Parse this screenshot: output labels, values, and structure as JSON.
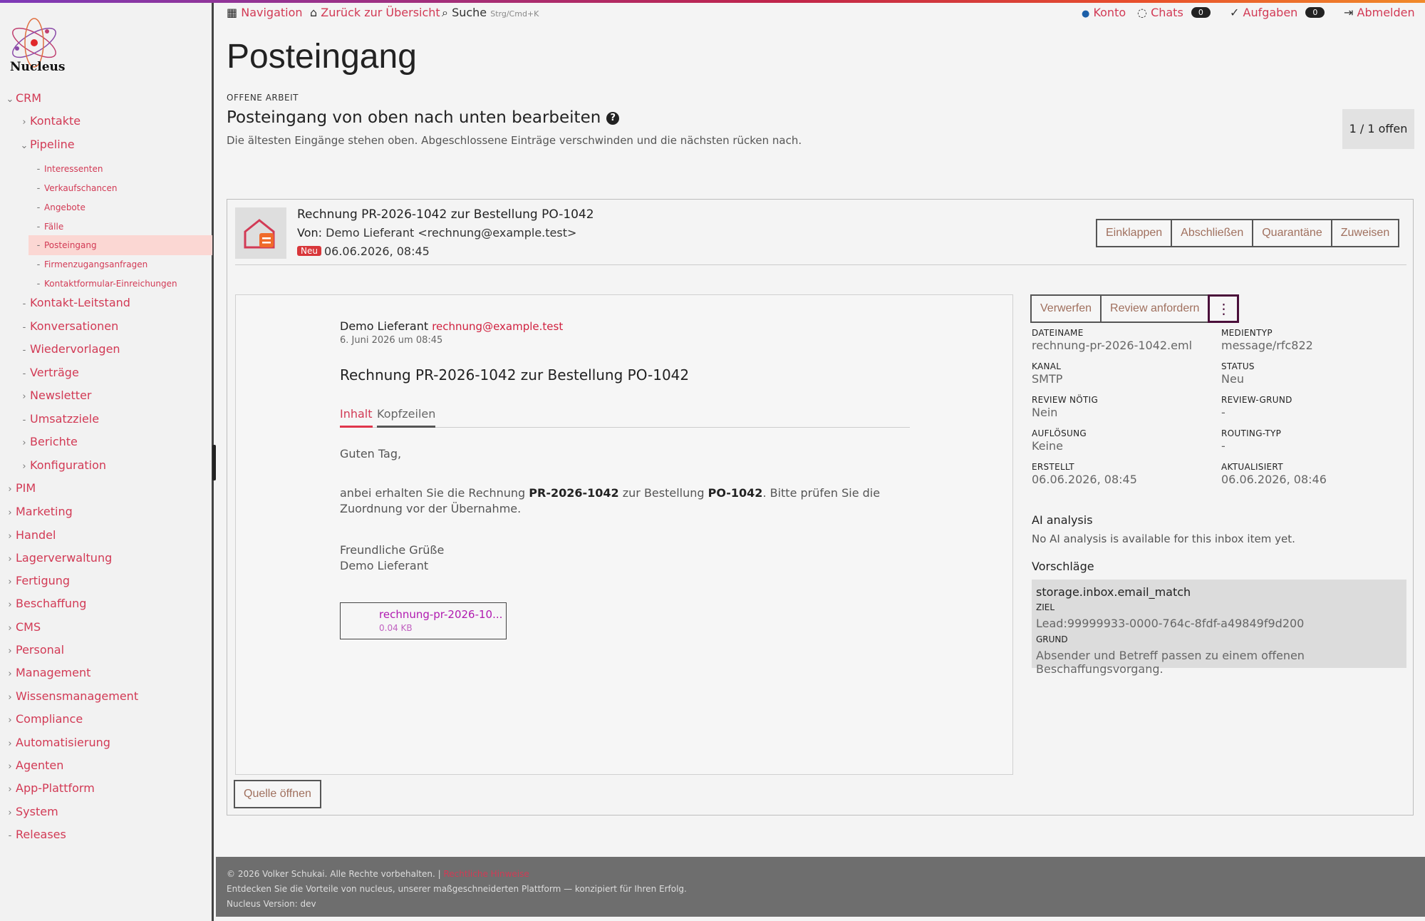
{
  "app": {
    "logo_text": "Nucleus"
  },
  "colors": {
    "accent": "#d23a55",
    "dark": "#222222",
    "active_nav_bg": "#fbd7d3",
    "neu_badge": "#d8363a",
    "footer_bg": "#6e6e6e"
  },
  "topbar": {
    "navigation": "Navigation",
    "back": "Zurück zur Übersicht",
    "search": "Suche",
    "search_hint": "Strg/Cmd+K",
    "konto": "Konto",
    "chats": "Chats",
    "chats_count": "0",
    "aufgaben": "Aufgaben",
    "aufgaben_count": "0",
    "abmelden": "Abmelden"
  },
  "sidebar": {
    "items": [
      {
        "label": "CRM",
        "level": 0,
        "chevron": "⌄"
      },
      {
        "label": "Kontakte",
        "level": 1,
        "chevron": "›"
      },
      {
        "label": "Pipeline",
        "level": 1,
        "chevron": "⌄"
      },
      {
        "label": "Interessenten",
        "level": 2,
        "chevron": "-"
      },
      {
        "label": "Verkaufschancen",
        "level": 2,
        "chevron": "-"
      },
      {
        "label": "Angebote",
        "level": 2,
        "chevron": "-"
      },
      {
        "label": "Fälle",
        "level": 2,
        "chevron": "-"
      },
      {
        "label": "Posteingang",
        "level": 2,
        "chevron": "-",
        "active": true
      },
      {
        "label": "Firmenzugangsanfragen",
        "level": 2,
        "chevron": "-"
      },
      {
        "label": "Kontaktformular-Einreichungen",
        "level": 2,
        "chevron": "-"
      },
      {
        "label": "Kontakt-Leitstand",
        "level": 1,
        "chevron": "-"
      },
      {
        "label": "Konversationen",
        "level": 1,
        "chevron": "-"
      },
      {
        "label": "Wiedervorlagen",
        "level": 1,
        "chevron": "-"
      },
      {
        "label": "Verträge",
        "level": 1,
        "chevron": "-"
      },
      {
        "label": "Newsletter",
        "level": 1,
        "chevron": "›"
      },
      {
        "label": "Umsatzziele",
        "level": 1,
        "chevron": "-"
      },
      {
        "label": "Berichte",
        "level": 1,
        "chevron": "›"
      },
      {
        "label": "Konfiguration",
        "level": 1,
        "chevron": "›"
      },
      {
        "label": "PIM",
        "level": 0,
        "chevron": "›"
      },
      {
        "label": "Marketing",
        "level": 0,
        "chevron": "›"
      },
      {
        "label": "Handel",
        "level": 0,
        "chevron": "›"
      },
      {
        "label": "Lagerverwaltung",
        "level": 0,
        "chevron": "›"
      },
      {
        "label": "Fertigung",
        "level": 0,
        "chevron": "›"
      },
      {
        "label": "Beschaffung",
        "level": 0,
        "chevron": "›"
      },
      {
        "label": "CMS",
        "level": 0,
        "chevron": "›"
      },
      {
        "label": "Personal",
        "level": 0,
        "chevron": "›"
      },
      {
        "label": "Management",
        "level": 0,
        "chevron": "›"
      },
      {
        "label": "Wissensmanagement",
        "level": 0,
        "chevron": "›"
      },
      {
        "label": "Compliance",
        "level": 0,
        "chevron": "›"
      },
      {
        "label": "Automatisierung",
        "level": 0,
        "chevron": "›"
      },
      {
        "label": "Agenten",
        "level": 0,
        "chevron": "›"
      },
      {
        "label": "App-Plattform",
        "level": 0,
        "chevron": "›"
      },
      {
        "label": "System",
        "level": 0,
        "chevron": "›"
      },
      {
        "label": "Releases",
        "level": 0,
        "chevron": "-"
      }
    ]
  },
  "page": {
    "title": "Posteingang",
    "eyebrow": "OFFENE ARBEIT",
    "heading": "Posteingang von oben nach unten bearbeiten",
    "help": "?",
    "subline": "Die ältesten Eingänge stehen oben. Abgeschlossene Einträge verschwinden und die nächsten rücken nach.",
    "counter": "1 / 1 offen"
  },
  "item": {
    "title": "Rechnung PR-2026-1042 zur Bestellung PO-1042",
    "from_label": "Von:",
    "from_value": "Demo Lieferant <rechnung@example.test>",
    "badge": "Neu",
    "date": "06.06.2026, 08:45",
    "actions": [
      "Einklappen",
      "Abschließen",
      "Quarantäne",
      "Zuweisen"
    ]
  },
  "mail": {
    "sender_name": "Demo Lieferant",
    "sender_email": "rechnung@example.test",
    "sent": "6. Juni 2026 um 08:45",
    "subject": "Rechnung PR-2026-1042 zur Bestellung PO-1042",
    "tab_content": "Inhalt",
    "tab_headers": "Kopfzeilen",
    "greeting": "Guten Tag,",
    "p1_a": "anbei erhalten Sie die Rechnung ",
    "p1_b": "PR-2026-1042",
    "p1_c": " zur Bestellung ",
    "p1_d": "PO-1042",
    "p1_e": ". Bitte prüfen Sie die Zuordnung vor der Übernahme.",
    "closing": "Freundliche Grüße",
    "signature": "Demo Lieferant",
    "attachment_name": "rechnung-pr-2026-10...",
    "attachment_size": "0.04 KB",
    "open_source": "Quelle öffnen"
  },
  "side_actions": [
    "Verwerfen",
    "Review anfordern"
  ],
  "side_more": "⋮",
  "meta": [
    {
      "label": "DATEINAME",
      "value": "rechnung-pr-2026-1042.eml"
    },
    {
      "label": "MEDIENTYP",
      "value": "message/rfc822"
    },
    {
      "label": "KANAL",
      "value": "SMTP"
    },
    {
      "label": "STATUS",
      "value": "Neu"
    },
    {
      "label": "REVIEW NÖTIG",
      "value": "Nein"
    },
    {
      "label": "REVIEW-GRUND",
      "value": "-"
    },
    {
      "label": "AUFLÖSUNG",
      "value": "Keine"
    },
    {
      "label": "ROUTING-TYP",
      "value": "-"
    },
    {
      "label": "ERSTELLT",
      "value": "06.06.2026, 08:45"
    },
    {
      "label": "AKTUALISIERT",
      "value": "06.06.2026, 08:46"
    }
  ],
  "ai": {
    "title": "AI analysis",
    "text": "No AI analysis is available for this inbox item yet."
  },
  "suggestions": {
    "title": "Vorschläge",
    "key": "storage.inbox.email_match",
    "ziel_label": "ZIEL",
    "ziel_value": "Lead:99999933-0000-764c-8fdf-a49849f9d200",
    "grund_label": "GRUND",
    "grund_value": "Absender und Betreff passen zu einem offenen Beschaffungsvorgang."
  },
  "footer": {
    "copyright": "© 2026 Volker Schukai. Alle Rechte vorbehalten. |",
    "legal": "Rechtliche Hinweise",
    "tagline": "Entdecken Sie die Vorteile von nucleus, unserer maßgeschneiderten Plattform — konzipiert für Ihren Erfolg.",
    "version": "Nucleus Version: dev"
  }
}
